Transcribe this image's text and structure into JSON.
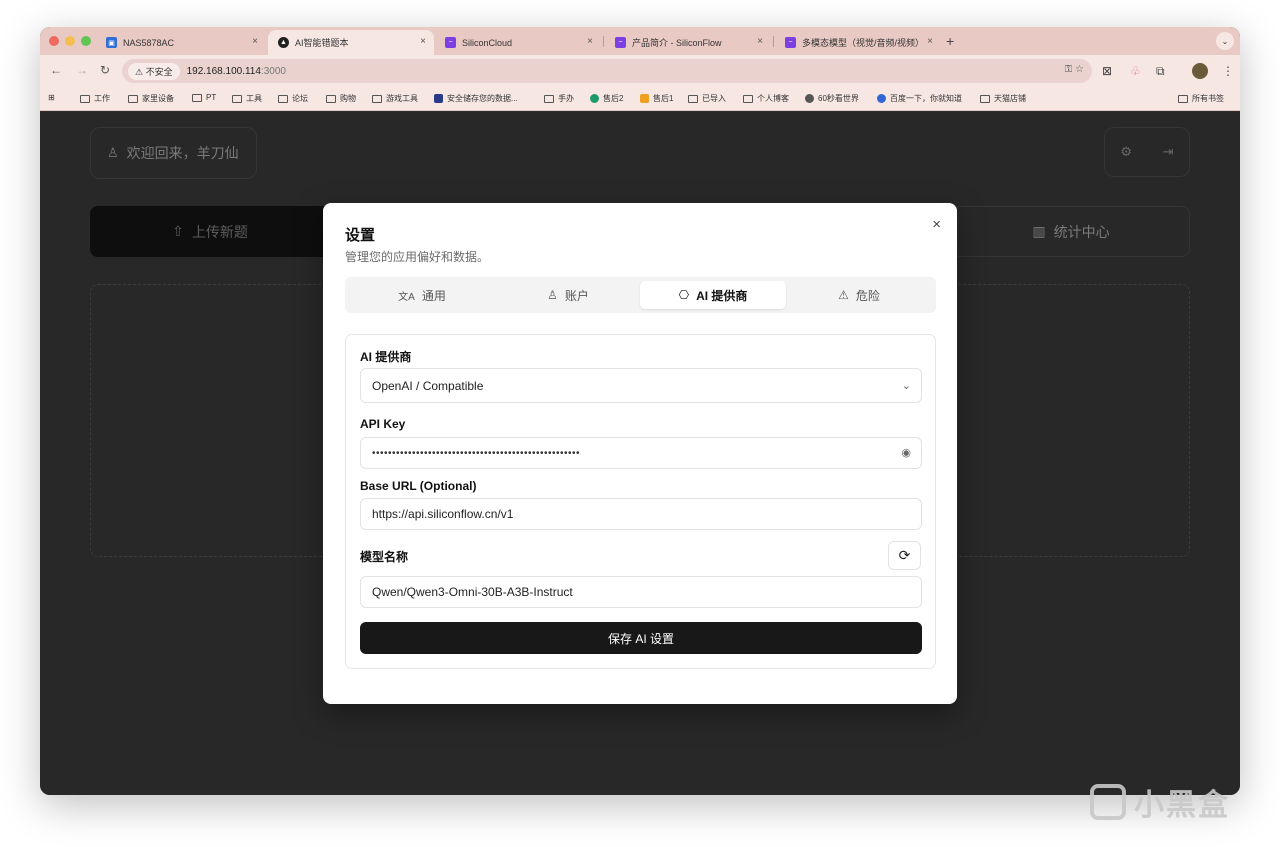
{
  "browser": {
    "tabs": [
      {
        "title": "NAS5878AC",
        "active": false
      },
      {
        "title": "AI智能错题本",
        "active": true
      },
      {
        "title": "SiliconCloud",
        "active": false
      },
      {
        "title": "产品简介 - SiliconFlow",
        "active": false
      },
      {
        "title": "多模态模型（视觉/音频/视频）",
        "active": false
      }
    ],
    "tab_close": "×",
    "new_tab": "+",
    "tab_menu": "⌄",
    "security_chip": "⚠ 不安全",
    "url_host": "192.168.100.114",
    "url_port": ":3000",
    "bookmarks": [
      {
        "label": "工作",
        "icon": "folder-icon"
      },
      {
        "label": "家里设备",
        "icon": "folder-icon"
      },
      {
        "label": "PT",
        "icon": "folder-icon"
      },
      {
        "label": "工具",
        "icon": "folder-icon"
      },
      {
        "label": "论坛",
        "icon": "folder-icon"
      },
      {
        "label": "购物",
        "icon": "folder-icon"
      },
      {
        "label": "游戏工具",
        "icon": "folder-icon"
      },
      {
        "label": "安全储存您的数据...",
        "icon": "site-icon"
      },
      {
        "label": "手办",
        "icon": "folder-icon"
      },
      {
        "label": "售后2",
        "icon": "site-icon"
      },
      {
        "label": "售后1",
        "icon": "site-icon"
      },
      {
        "label": "已导入",
        "icon": "folder-icon"
      },
      {
        "label": "个人博客",
        "icon": "folder-icon"
      },
      {
        "label": "60秒看世界",
        "icon": "site-icon"
      },
      {
        "label": "百度一下，你就知道",
        "icon": "site-icon"
      },
      {
        "label": "天猫店铺",
        "icon": "folder-icon"
      }
    ],
    "all_bookmarks": "所有书签"
  },
  "app": {
    "welcome": "欢迎回来，羊刀仙",
    "upload_label": "上传新题",
    "stats_label": "统计中心"
  },
  "settings": {
    "title": "设置",
    "subtitle": "管理您的应用偏好和数据。",
    "close": "×",
    "tabs": [
      {
        "label": "通用",
        "icon": "translate-icon",
        "glyph": "文A"
      },
      {
        "label": "账户",
        "icon": "user-icon",
        "glyph": "♙"
      },
      {
        "label": "AI 提供商",
        "icon": "bot-icon",
        "glyph": "⎔"
      },
      {
        "label": "危险",
        "icon": "warning-icon",
        "glyph": "⚠"
      }
    ],
    "active_tab": "AI 提供商",
    "provider_label": "AI 提供商",
    "provider_value": "OpenAI / Compatible",
    "api_key_label": "API Key",
    "api_key_masked": "••••••••••••••••••••••••••••••••••••••••••••••••••••",
    "base_url_label": "Base URL (Optional)",
    "base_url_value": "https://api.siliconflow.cn/v1",
    "model_label": "模型名称",
    "model_value": "Qwen/Qwen3-Omni-30B-A3B-Instruct",
    "save_label": "保存 AI 设置"
  },
  "watermark": "小黑盒",
  "colors": {
    "tabstrip": "#e9c9c3",
    "toolbar": "#f6e7e3",
    "page_bg": "#282828",
    "primary_button": "#181818"
  }
}
